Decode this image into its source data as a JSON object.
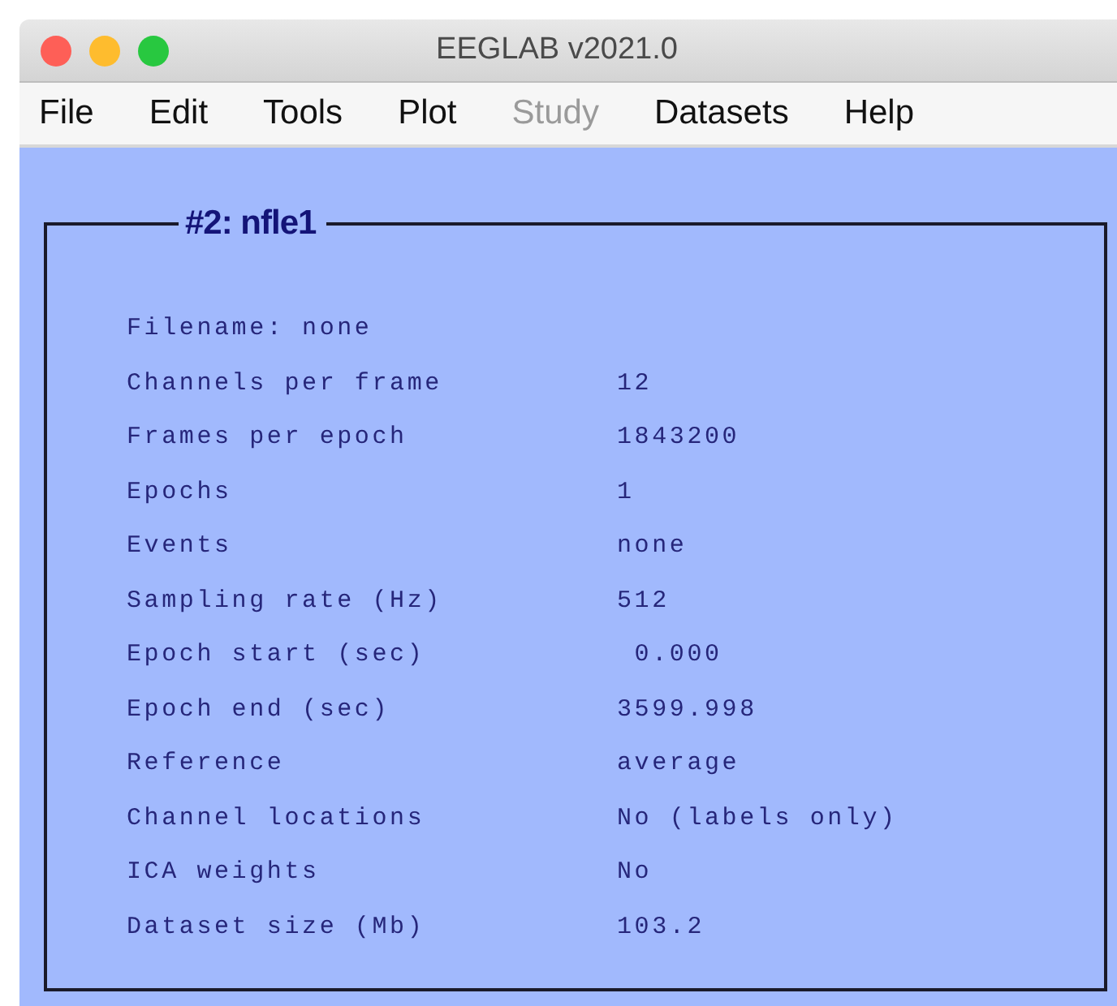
{
  "window": {
    "title": "EEGLAB v2021.0"
  },
  "menu": [
    {
      "label": "File",
      "disabled": false
    },
    {
      "label": "Edit",
      "disabled": false
    },
    {
      "label": "Tools",
      "disabled": false
    },
    {
      "label": "Plot",
      "disabled": false
    },
    {
      "label": "Study",
      "disabled": true
    },
    {
      "label": "Datasets",
      "disabled": false
    },
    {
      "label": "Help",
      "disabled": false
    }
  ],
  "panel": {
    "title": "#2: nfle1",
    "rows": [
      {
        "label": "Filename: none"
      },
      {
        "label": "Channels per frame",
        "value": "12"
      },
      {
        "label": "Frames per epoch",
        "value": "1843200"
      },
      {
        "label": "Epochs",
        "value": "1"
      },
      {
        "label": "Events",
        "value": "none"
      },
      {
        "label": "Sampling rate (Hz)",
        "value": "512"
      },
      {
        "label": "Epoch start (sec)",
        "value": " 0.000"
      },
      {
        "label": "Epoch end (sec)",
        "value": "3599.998"
      },
      {
        "label": "Reference",
        "value": "average"
      },
      {
        "label": "Channel locations",
        "value": "No (labels only)"
      },
      {
        "label": "ICA weights",
        "value": "No"
      },
      {
        "label": "Dataset size (Mb)",
        "value": "103.2"
      }
    ]
  }
}
